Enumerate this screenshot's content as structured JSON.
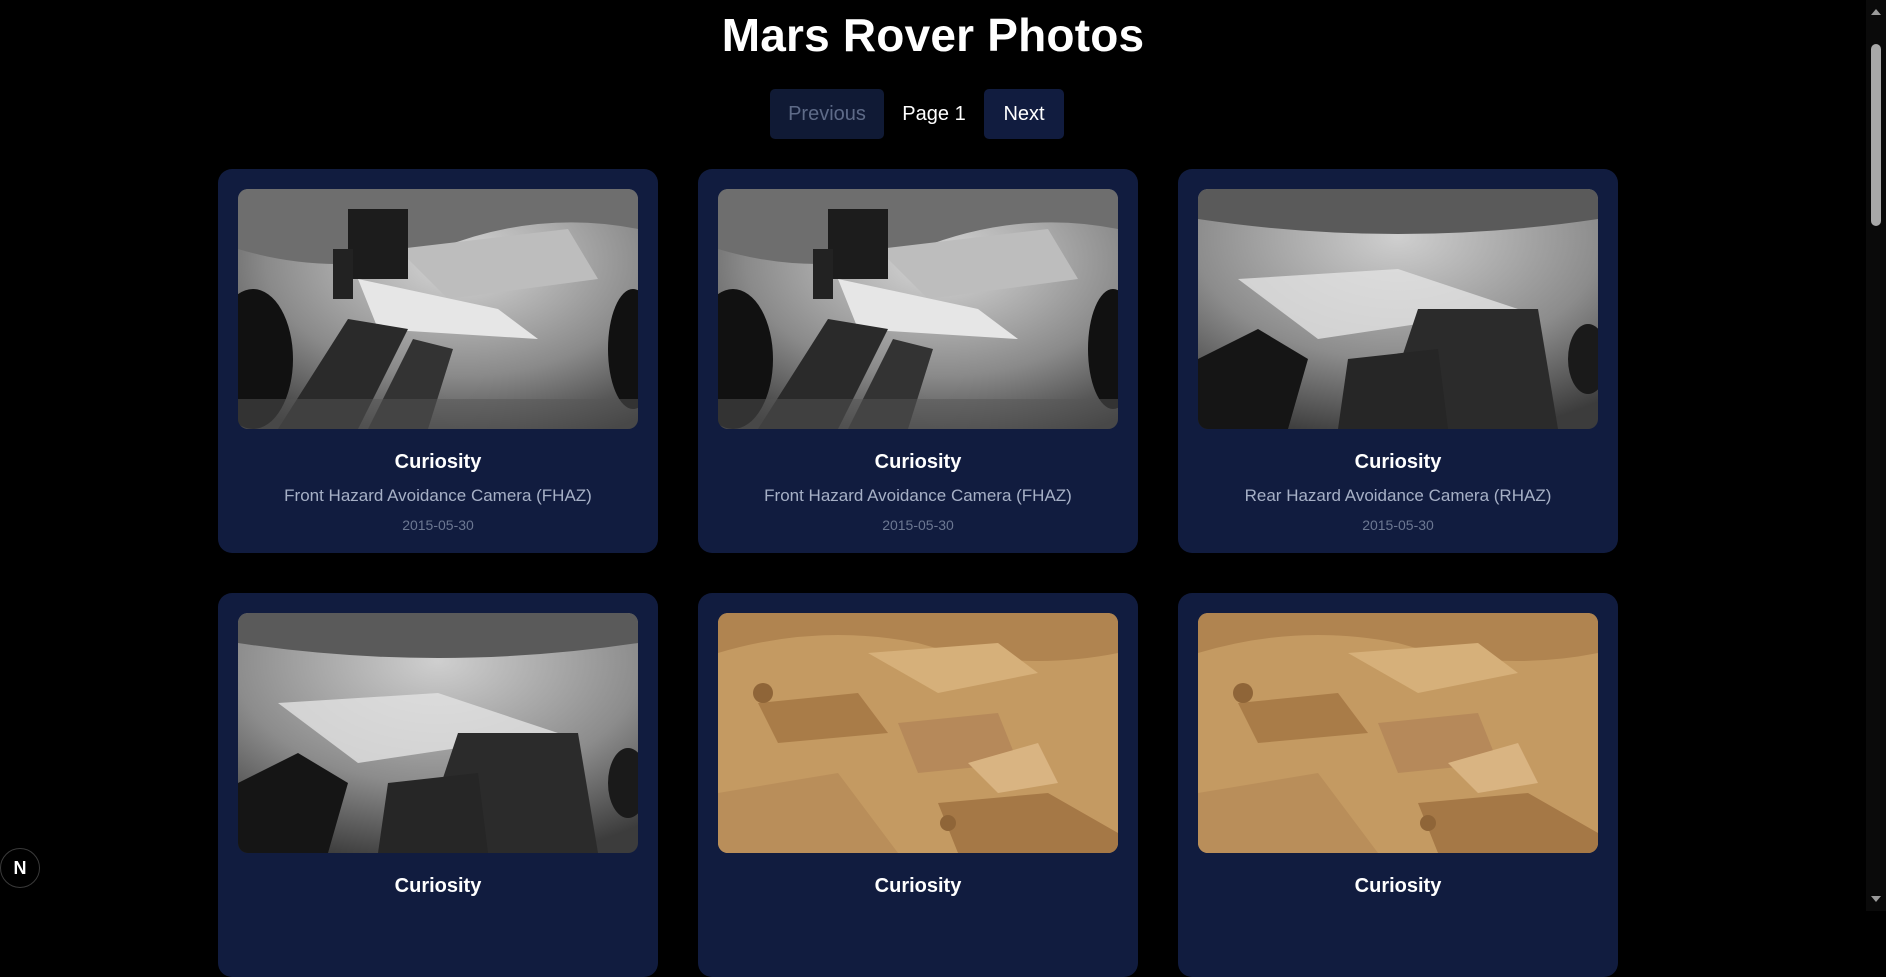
{
  "header": {
    "title": "Mars Rover Photos"
  },
  "pagination": {
    "previous_label": "Previous",
    "page_label": "Page 1",
    "next_label": "Next"
  },
  "photos": [
    {
      "rover": "Curiosity",
      "camera": "Front Hazard Avoidance Camera (FHAZ)",
      "date": "2015-05-30",
      "style": "gray-front"
    },
    {
      "rover": "Curiosity",
      "camera": "Front Hazard Avoidance Camera (FHAZ)",
      "date": "2015-05-30",
      "style": "gray-front"
    },
    {
      "rover": "Curiosity",
      "camera": "Rear Hazard Avoidance Camera (RHAZ)",
      "date": "2015-05-30",
      "style": "gray-rear"
    },
    {
      "rover": "Curiosity",
      "camera": "",
      "date": "",
      "style": "gray-rear"
    },
    {
      "rover": "Curiosity",
      "camera": "",
      "date": "",
      "style": "color"
    },
    {
      "rover": "Curiosity",
      "camera": "",
      "date": "",
      "style": "color"
    }
  ],
  "colors": {
    "background": "#000000",
    "card": "#111c3f",
    "button": "#111c3f",
    "muted_text": "#a6b0c6"
  },
  "badge": {
    "letter": "N",
    "icon": "nextjs-badge-icon"
  }
}
